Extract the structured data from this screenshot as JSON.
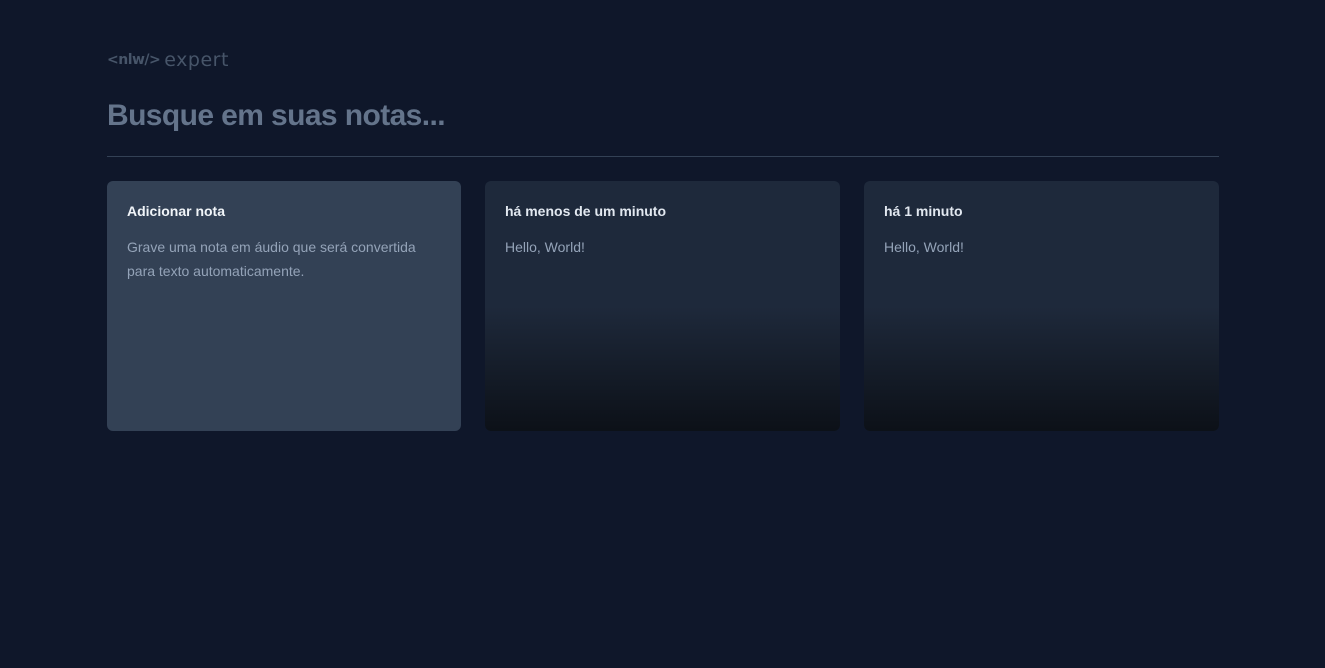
{
  "logo": {
    "brand": "<nlw/>",
    "product": "expert"
  },
  "search": {
    "placeholder": "Busque em suas notas..."
  },
  "add_card": {
    "title": "Adicionar nota",
    "description": "Grave uma nota em áudio que será convertida para texto automaticamente."
  },
  "notes": [
    {
      "date": "há menos de um minuto",
      "content": "Hello, World!"
    },
    {
      "date": "há 1 minuto",
      "content": "Hello, World!"
    }
  ],
  "colors": {
    "background": "#0f172a",
    "add_card": "#334155",
    "note_card": "#1e293b",
    "divider": "#334155"
  }
}
